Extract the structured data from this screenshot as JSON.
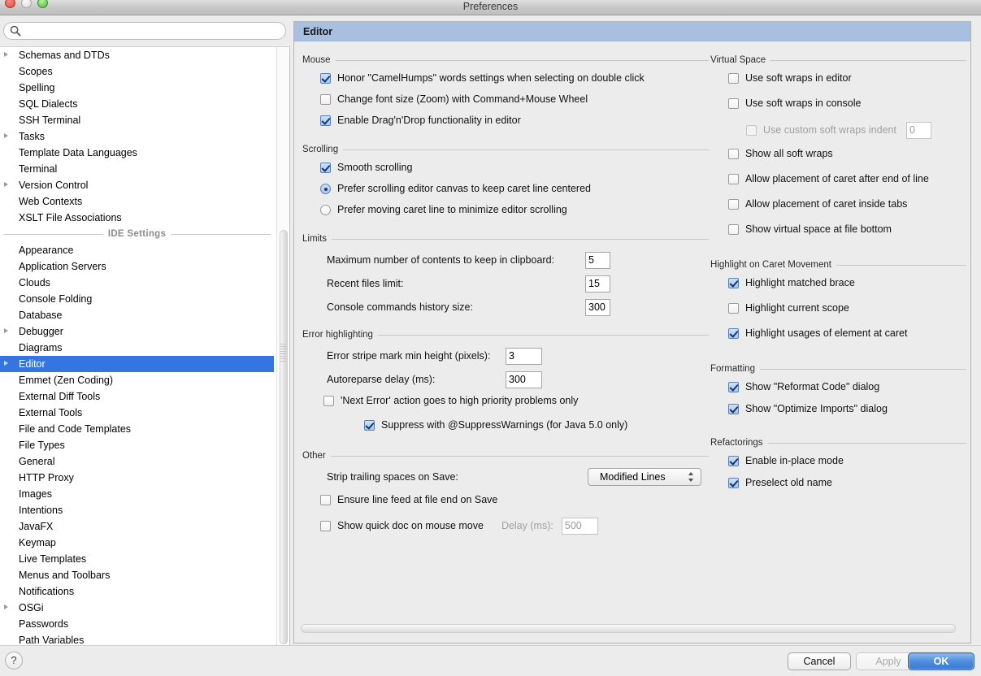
{
  "window": {
    "title": "Preferences",
    "traffic_lights": [
      "close-button",
      "minimize-button",
      "maximize-button"
    ]
  },
  "sidebar": {
    "search": {
      "value": "",
      "placeholder": "",
      "icon": "search-icon"
    },
    "project_items": [
      {
        "label": "Schemas and DTDs",
        "expandable": true
      },
      {
        "label": "Scopes",
        "expandable": false
      },
      {
        "label": "Spelling",
        "expandable": false
      },
      {
        "label": "SQL Dialects",
        "expandable": false
      },
      {
        "label": "SSH Terminal",
        "expandable": false
      },
      {
        "label": "Tasks",
        "expandable": true
      },
      {
        "label": "Template Data Languages",
        "expandable": false
      },
      {
        "label": "Terminal",
        "expandable": false
      },
      {
        "label": "Version Control",
        "expandable": true
      },
      {
        "label": "Web Contexts",
        "expandable": false
      },
      {
        "label": "XSLT File Associations",
        "expandable": false
      }
    ],
    "group_label": "IDE Settings",
    "ide_items": [
      {
        "label": "Appearance",
        "expandable": false,
        "selected": false
      },
      {
        "label": "Application Servers",
        "expandable": false,
        "selected": false
      },
      {
        "label": "Clouds",
        "expandable": false,
        "selected": false
      },
      {
        "label": "Console Folding",
        "expandable": false,
        "selected": false
      },
      {
        "label": "Database",
        "expandable": false,
        "selected": false
      },
      {
        "label": "Debugger",
        "expandable": true,
        "selected": false
      },
      {
        "label": "Diagrams",
        "expandable": false,
        "selected": false
      },
      {
        "label": "Editor",
        "expandable": true,
        "selected": true
      },
      {
        "label": "Emmet (Zen Coding)",
        "expandable": false,
        "selected": false
      },
      {
        "label": "External Diff Tools",
        "expandable": false,
        "selected": false
      },
      {
        "label": "External Tools",
        "expandable": false,
        "selected": false
      },
      {
        "label": "File and Code Templates",
        "expandable": false,
        "selected": false
      },
      {
        "label": "File Types",
        "expandable": false,
        "selected": false
      },
      {
        "label": "General",
        "expandable": false,
        "selected": false
      },
      {
        "label": "HTTP Proxy",
        "expandable": false,
        "selected": false
      },
      {
        "label": "Images",
        "expandable": false,
        "selected": false
      },
      {
        "label": "Intentions",
        "expandable": false,
        "selected": false
      },
      {
        "label": "JavaFX",
        "expandable": false,
        "selected": false
      },
      {
        "label": "Keymap",
        "expandable": false,
        "selected": false
      },
      {
        "label": "Live Templates",
        "expandable": false,
        "selected": false
      },
      {
        "label": "Menus and Toolbars",
        "expandable": false,
        "selected": false
      },
      {
        "label": "Notifications",
        "expandable": false,
        "selected": false
      },
      {
        "label": "OSGi",
        "expandable": true,
        "selected": false
      },
      {
        "label": "Passwords",
        "expandable": false,
        "selected": false
      },
      {
        "label": "Path Variables",
        "expandable": false,
        "selected": false
      }
    ]
  },
  "main": {
    "header": "Editor",
    "left": {
      "mouse": {
        "title": "Mouse",
        "camel_humps": {
          "label": "Honor \"CamelHumps\" words settings when selecting on double click",
          "checked": true
        },
        "font_zoom": {
          "label": "Change font size (Zoom) with Command+Mouse Wheel",
          "checked": false
        },
        "drag_drop": {
          "label": "Enable Drag'n'Drop functionality in editor",
          "checked": true
        }
      },
      "scrolling": {
        "title": "Scrolling",
        "smooth": {
          "label": "Smooth scrolling",
          "checked": true
        },
        "prefer_canvas": {
          "label": "Prefer scrolling editor canvas to keep caret line centered",
          "checked": true
        },
        "prefer_caret": {
          "label": "Prefer moving caret line to minimize editor scrolling",
          "checked": false
        }
      },
      "limits": {
        "title": "Limits",
        "clipboard": {
          "label": "Maximum number of contents to keep in clipboard:",
          "value": "5"
        },
        "recent_files": {
          "label": "Recent files limit:",
          "value": "15"
        },
        "console_history": {
          "label": "Console commands history size:",
          "value": "300"
        }
      },
      "error_highlighting": {
        "title": "Error highlighting",
        "stripe_height": {
          "label": "Error stripe mark min height (pixels):",
          "value": "3"
        },
        "autoreparse": {
          "label": "Autoreparse delay (ms):",
          "value": "300"
        },
        "next_error": {
          "label": "'Next Error' action goes to high priority problems only",
          "checked": false
        },
        "suppress": {
          "label": "Suppress with @SuppressWarnings (for Java 5.0 only)",
          "checked": true
        }
      },
      "other": {
        "title": "Other",
        "strip_spaces": {
          "label": "Strip trailing spaces on Save:",
          "value": "Modified Lines"
        },
        "line_feed": {
          "label": "Ensure line feed at file end on Save",
          "checked": false
        },
        "quick_doc": {
          "label": "Show quick doc on mouse move",
          "checked": false
        },
        "delay": {
          "label": "Delay (ms):",
          "value": "500"
        }
      }
    },
    "right": {
      "virtual_space": {
        "title": "Virtual Space",
        "soft_wraps_editor": {
          "label": "Use soft wraps in editor",
          "checked": false
        },
        "soft_wraps_console": {
          "label": "Use soft wraps in console",
          "checked": false
        },
        "custom_indent": {
          "label": "Use custom soft wraps indent",
          "checked": false,
          "value": "0"
        },
        "show_all_soft_wraps": {
          "label": "Show all soft wraps",
          "checked": false
        },
        "caret_after_eol": {
          "label": "Allow placement of caret after end of line",
          "checked": false
        },
        "caret_inside_tabs": {
          "label": "Allow placement of caret inside tabs",
          "checked": false
        },
        "virtual_space_bottom": {
          "label": "Show virtual space at file bottom",
          "checked": false
        }
      },
      "highlight": {
        "title": "Highlight on Caret Movement",
        "matched_brace": {
          "label": "Highlight matched brace",
          "checked": true
        },
        "current_scope": {
          "label": "Highlight current scope",
          "checked": false
        },
        "usages": {
          "label": "Highlight usages of element at caret",
          "checked": true
        }
      },
      "formatting": {
        "title": "Formatting",
        "reformat_dialog": {
          "label": "Show \"Reformat Code\" dialog",
          "checked": true
        },
        "optimize_dialog": {
          "label": "Show \"Optimize Imports\" dialog",
          "checked": true
        }
      },
      "refactorings": {
        "title": "Refactorings",
        "in_place": {
          "label": "Enable in-place mode",
          "checked": true
        },
        "preselect": {
          "label": "Preselect old name",
          "checked": true
        }
      }
    }
  },
  "footer": {
    "help": "?",
    "cancel": "Cancel",
    "apply": "Apply",
    "ok": "OK"
  },
  "colors": {
    "selection": "#3575e0",
    "header_band": "#a9bfe0",
    "ok_button": "#4d8ede",
    "window_bg": "#ececec"
  }
}
